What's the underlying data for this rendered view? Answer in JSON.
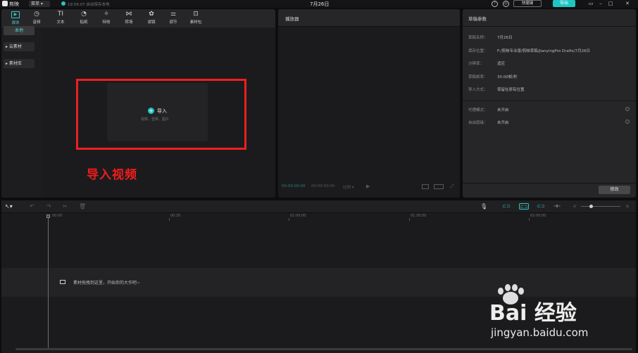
{
  "topbar": {
    "app_name": "剪映",
    "menu_label": "菜单",
    "autosave_text": "19:56:07 自动保存本地",
    "title": "7月26日",
    "shortcut_label": "快捷键",
    "export_label": "导出"
  },
  "media_toolbar": {
    "tabs": [
      {
        "label": "媒体",
        "icon": "media-icon",
        "active": true
      },
      {
        "label": "音频",
        "icon": "audio-icon",
        "active": false
      },
      {
        "label": "文本",
        "icon": "text-icon",
        "active": false
      },
      {
        "label": "贴纸",
        "icon": "sticker-icon",
        "active": false
      },
      {
        "label": "特效",
        "icon": "effect-icon",
        "active": false
      },
      {
        "label": "转场",
        "icon": "transition-icon",
        "active": false
      },
      {
        "label": "滤镜",
        "icon": "filter-icon",
        "active": false
      },
      {
        "label": "调节",
        "icon": "adjust-icon",
        "active": false
      },
      {
        "label": "素材包",
        "icon": "pack-icon",
        "active": false
      }
    ]
  },
  "media_sidebar": {
    "local": "本地",
    "cloud": "▸ 云素材",
    "library": "▸ 素材库"
  },
  "import": {
    "label": "导入",
    "hint": "视频、音频、图片"
  },
  "annotation": "导入视频",
  "player": {
    "title": "播放器",
    "time_current": "00:00:00:00",
    "time_total": "00:00:00:00",
    "ratio": "比例 ▾"
  },
  "params": {
    "title": "草稿参数",
    "rows": [
      {
        "k": "草稿名称：",
        "v": "7月26日"
      },
      {
        "k": "保存位置：",
        "v": "F:/剪映专业版/剪映草稿/JianyingPro Drafts/7月26日"
      },
      {
        "k": "分辨率：",
        "v": "适应"
      },
      {
        "k": "草稿帧率：",
        "v": "30.00帧/秒"
      },
      {
        "k": "导入方式：",
        "v": "保留在原有位置"
      }
    ],
    "rows2": [
      {
        "k": "代理模式：",
        "v": "未开启"
      },
      {
        "k": "自由层级：",
        "v": "未开启"
      }
    ],
    "modify_label": "修改"
  },
  "timeline": {
    "ruler": [
      "00:00",
      "00:30",
      "01:00:00",
      "01:30:00",
      "02:00:00"
    ],
    "hint": "素材拖拽到这里，开始你的大作吧~"
  },
  "watermark": {
    "brand": "Bai 经验",
    "url": "jingyan.baidu.com"
  }
}
